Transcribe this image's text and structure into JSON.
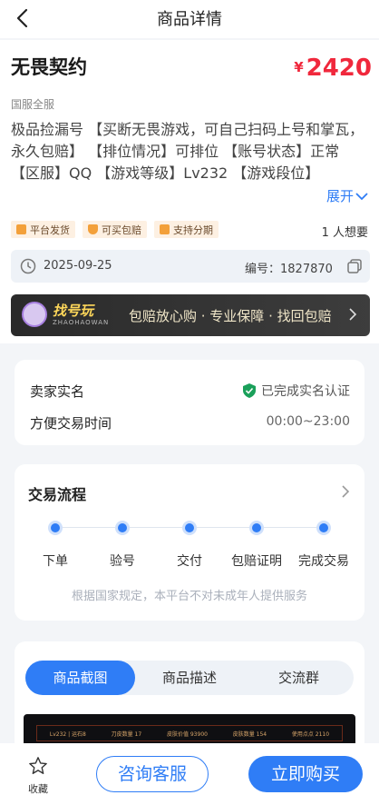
{
  "header": {
    "title": "商品详情"
  },
  "product": {
    "title": "无畏契约",
    "currency": "¥",
    "price": "2420",
    "region": "国服全服",
    "description": "极品捡漏号 【买断无畏游戏，可自己扫码上号和掌瓦，永久包赔】 【排位情况】可排位 【账号状态】正常 【区服】QQ 【游戏等级】Lv232 【游戏段位】",
    "expand_label": "展开"
  },
  "tags": [
    "平台发货",
    "可买包赔",
    "支持分期"
  ],
  "wants": "1 人想要",
  "listing": {
    "date": "2025-09-25",
    "code": "编号：1827870"
  },
  "banner": {
    "brand": "找号玩",
    "brand_sub": "ZHAOHAOWAN",
    "slogan": "包赔放心购 · 专业保障 · 找回包赔"
  },
  "seller": {
    "name_label": "卖家实名",
    "verified": "已完成实名认证",
    "time_label": "方便交易时间",
    "time": "00:00~23:00"
  },
  "process": {
    "title": "交易流程",
    "steps": [
      "下单",
      "验号",
      "交付",
      "包赔证明",
      "完成交易"
    ],
    "notice": "根据国家规定，本平台不对未成年人提供服务"
  },
  "tabs": [
    "商品截图",
    "商品描述",
    "交流群"
  ],
  "screenshot_bar": [
    "Lv232 | 运石8",
    "刀皮数量 17",
    "皮肤价值 93900",
    "皮肤数量 154",
    "使用点点 2110"
  ],
  "footer": {
    "fav": "收藏",
    "consult": "咨询客服",
    "buy": "立即购买"
  },
  "colors": {
    "accent": "#2f7df6",
    "price": "#f0283c",
    "tag_bg": "#fdf0e2",
    "verified": "#1aa05a"
  }
}
